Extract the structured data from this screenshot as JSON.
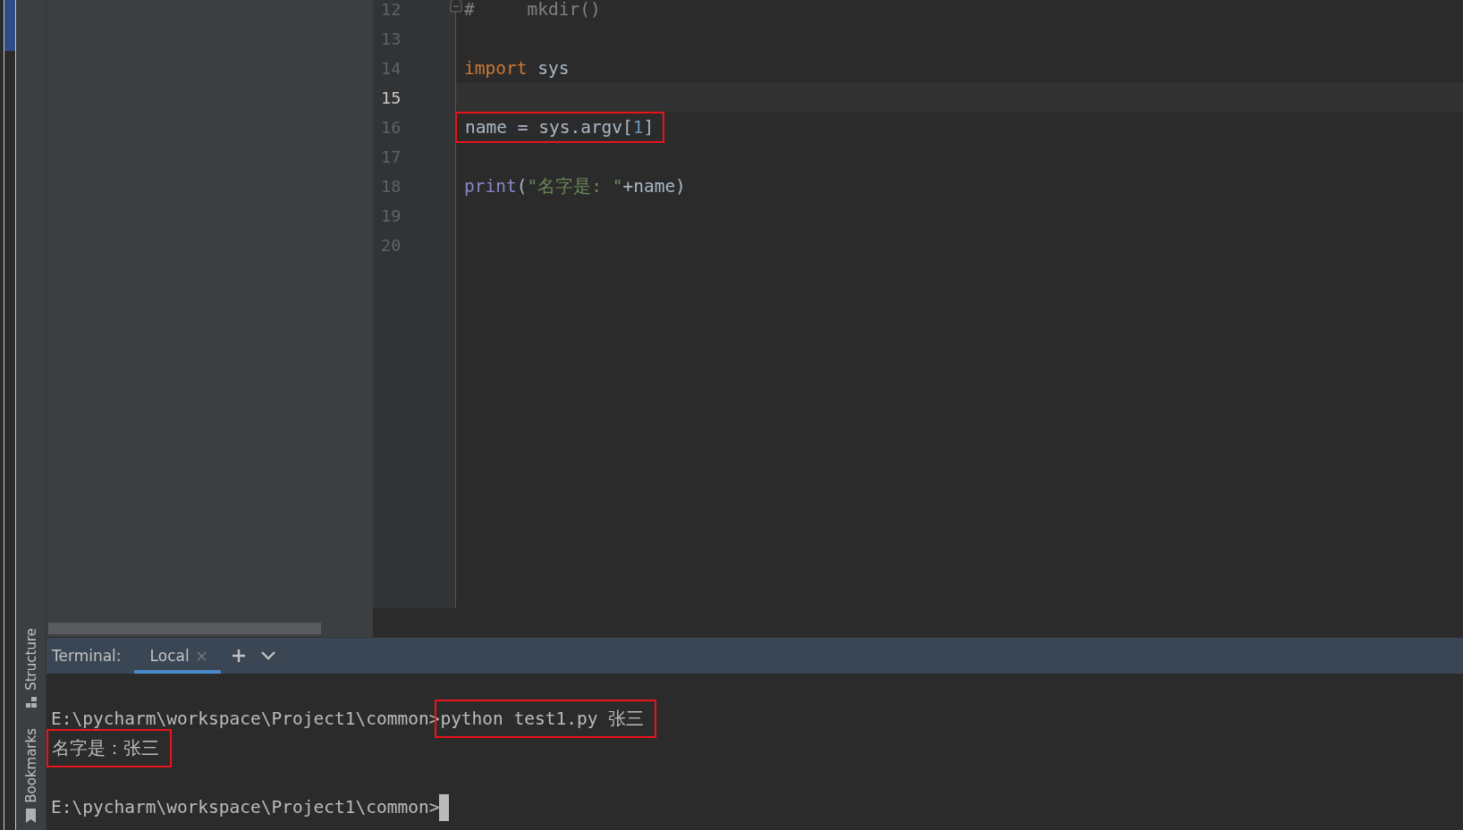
{
  "tool_strip": {
    "tabs": [
      {
        "label": "Structure",
        "kind": "structure",
        "selected": false
      },
      {
        "label": "Bookmarks",
        "kind": "bookmarks",
        "selected": false
      }
    ]
  },
  "editor": {
    "lines": [
      {
        "number": "12",
        "current": false,
        "fold": true,
        "tokens": [
          {
            "text": "#     mkdir()",
            "kind": "comment"
          }
        ]
      },
      {
        "number": "13",
        "current": false
      },
      {
        "number": "14",
        "current": false,
        "tokens": [
          {
            "text": "import",
            "kind": "keyword"
          },
          {
            "text": " sys",
            "kind": "plain"
          }
        ]
      },
      {
        "number": "15",
        "current": true
      },
      {
        "number": "16",
        "current": false,
        "boxed": true,
        "tokens": [
          {
            "text": "name = sys.argv[",
            "kind": "plain"
          },
          {
            "text": "1",
            "kind": "number"
          },
          {
            "text": "]",
            "kind": "plain"
          }
        ]
      },
      {
        "number": "17",
        "current": false
      },
      {
        "number": "18",
        "current": false,
        "tokens": [
          {
            "text": "print",
            "kind": "builtin"
          },
          {
            "text": "(",
            "kind": "plain"
          },
          {
            "text": "\"名字是: \"",
            "kind": "string"
          },
          {
            "text": "+name)",
            "kind": "plain"
          }
        ]
      },
      {
        "number": "19",
        "current": false
      },
      {
        "number": "20",
        "current": false
      }
    ]
  },
  "terminal": {
    "title": "Terminal:",
    "tabs": [
      {
        "label": "Local",
        "selected": true
      }
    ],
    "lines": [
      {
        "segments": [
          {
            "text": "E:\\pycharm\\workspace\\Project1\\common>"
          },
          {
            "text": "python test1.py 张三",
            "boxed": true
          }
        ]
      },
      {
        "segments": [
          {
            "text": "名字是：张三",
            "boxed": true
          }
        ]
      },
      {
        "cursor": true,
        "segments": [
          {
            "text": "E:\\pycharm\\workspace\\Project1\\common>"
          }
        ]
      }
    ]
  }
}
